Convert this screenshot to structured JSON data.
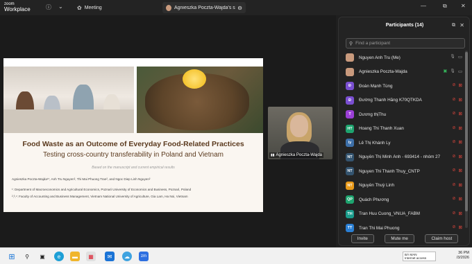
{
  "titlebar": {
    "brand_line1": "zoom",
    "brand_line2": "Workplace",
    "tab_meeting": "Meeting",
    "tab_screen": "Agnieszka Poczta-Wajda's screen"
  },
  "slide": {
    "title": "Food Waste as an Outcome of Everyday Food-Related Practices",
    "subtitle": "Testing cross-country transferability in Poland and Vietnam",
    "note": "Based on the manuscript and current empirical results",
    "authors": "Agnieszka Poczta-Wajda¹*, Anh Tru Nguyen², Thi Mai Phuong Tran², and Ngoc Diep Linh Nguyen²",
    "affiliation1": "¹: Department of Macroeconomics and Agricultural Economics, Poznań University of Economics and Business, Poznań, Poland",
    "affiliation2": "²,³,⁴: Faculty of Accounting and Business Management, Vietnam National University of Agriculture, Gia Lam, Ha Noi, Vietnam"
  },
  "video": {
    "label": "Agnieszka Poczta-Wajda"
  },
  "participants": {
    "header": "Participants (14)",
    "search_placeholder": "Find a participant",
    "list": [
      {
        "initials": "",
        "name": "Nguyen Anh Tru (Me)",
        "color": "#c99a7d",
        "photo": true,
        "mic": "on",
        "cam": "on",
        "share": false
      },
      {
        "initials": "",
        "name": "Agnieszka Poczta-Wajda",
        "color": "#c99a7d",
        "photo": true,
        "mic": "on",
        "cam": "on",
        "share": true
      },
      {
        "initials": "Đ",
        "name": "Đoàn Mạnh Tùng",
        "color": "#7a4fd1",
        "photo": false,
        "mic": "off",
        "cam": "off",
        "share": false
      },
      {
        "initials": "Đ",
        "name": "Đường Thanh Hằng K70QTKDA",
        "color": "#7a4fd1",
        "photo": false,
        "mic": "off",
        "cam": "off",
        "share": false
      },
      {
        "initials": "T",
        "name": "Dương thịThu",
        "color": "#9b3fd6",
        "photo": false,
        "mic": "off",
        "cam": "off",
        "share": false
      },
      {
        "initials": "HT",
        "name": "Hoang Thi Thanh Xuan",
        "color": "#1ea46f",
        "photo": false,
        "mic": "off",
        "cam": "off",
        "share": false
      },
      {
        "initials": "ly",
        "name": "Lê Thị Khánh Ly",
        "color": "#3d6fa8",
        "photo": false,
        "mic": "off",
        "cam": "off",
        "share": false
      },
      {
        "initials": "NT",
        "name": "Nguyễn Thị Minh Ánh - 693414 - nhóm 27",
        "color": "#34546f",
        "photo": false,
        "mic": "off",
        "cam": "off",
        "share": false
      },
      {
        "initials": "NT",
        "name": "Nguyen Thi Thanh Thuy_CNTP",
        "color": "#34546f",
        "photo": false,
        "mic": "off",
        "cam": "off",
        "share": false
      },
      {
        "initials": "NT",
        "name": "Nguyễn Thuỳ Linh",
        "color": "#e89a1a",
        "photo": false,
        "mic": "off",
        "cam": "off",
        "share": false
      },
      {
        "initials": "QP",
        "name": "Quách Phương",
        "color": "#1ea46f",
        "photo": false,
        "mic": "off",
        "cam": "off",
        "share": false
      },
      {
        "initials": "TH",
        "name": "Tran Huu Cuong_VNUA_FABM",
        "color": "#1a9b8b",
        "photo": false,
        "mic": "off",
        "cam": "off",
        "share": false
      },
      {
        "initials": "TT",
        "name": "Tran Thi Mai Phuong",
        "color": "#2a7fd4",
        "photo": false,
        "mic": "off",
        "cam": "off",
        "share": false
      }
    ],
    "btn_invite": "Invite",
    "btn_mute": "Mute me",
    "btn_claim": "Claim host"
  },
  "taskbar": {
    "notif_line1": "BÁ MAN",
    "notif_line2": "Internet access",
    "time": "36 PM",
    "date": "/3/2026"
  }
}
